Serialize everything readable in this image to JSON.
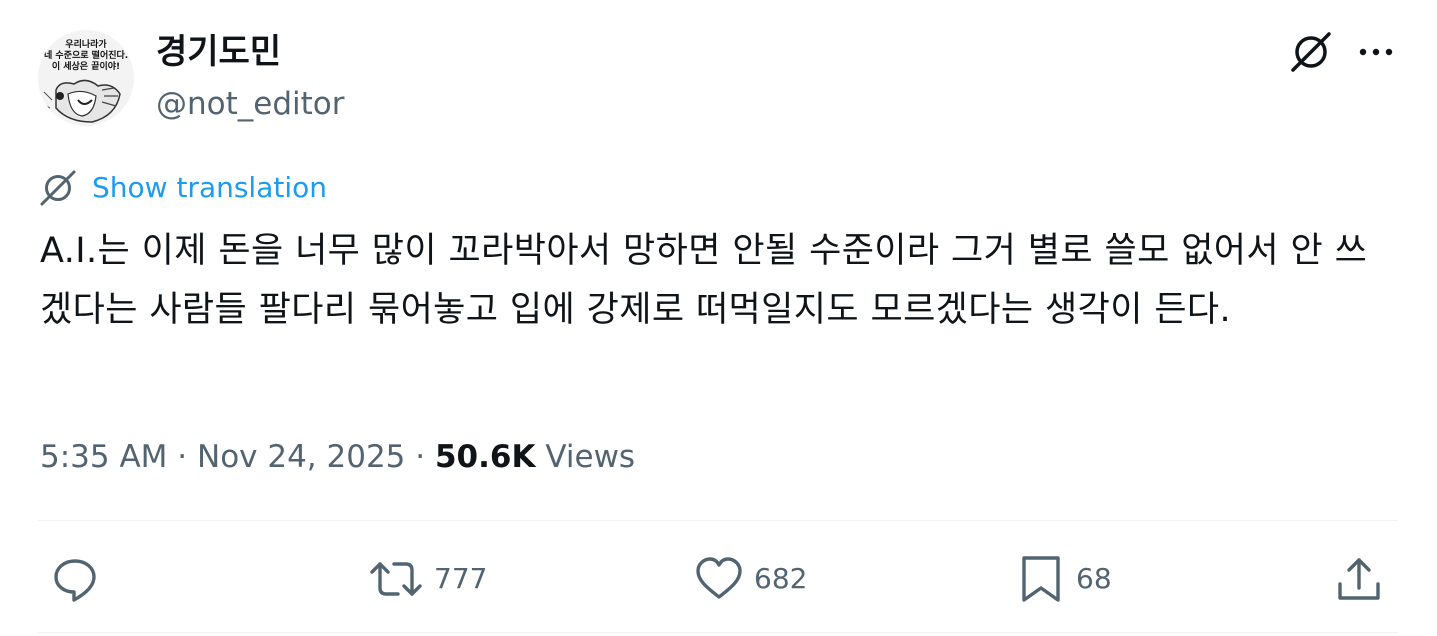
{
  "author": {
    "display_name": "경기도민",
    "handle": "@not_editor",
    "avatar_caption": [
      "우리나라가",
      "네 수준으로 떨어진다.",
      "이 세상은 끝이야!"
    ]
  },
  "header": {
    "grok_icon": "grok-icon",
    "more_icon": "more-icon"
  },
  "translate": {
    "label": "Show translation",
    "icon": "grok-icon"
  },
  "tweet": {
    "text": "A.I.는 이제 돈을 너무 많이 꼬라박아서 망하면 안될 수준이라 그거 별로 쓸모 없어서 안 쓰겠다는 사람들 팔다리 묶어놓고 입에 강제로 떠먹일지도 모르겠다는 생각이 든다."
  },
  "meta": {
    "time": "5:35 AM",
    "separator": "·",
    "date": "Nov 24, 2025",
    "views_count": "50.6K",
    "views_label": "Views"
  },
  "actions": {
    "reply": {
      "icon": "reply-icon",
      "count": ""
    },
    "repost": {
      "icon": "repost-icon",
      "count": "777"
    },
    "like": {
      "icon": "heart-icon",
      "count": "682"
    },
    "bookmark": {
      "icon": "bookmark-icon",
      "count": "68"
    },
    "share": {
      "icon": "share-icon",
      "count": ""
    }
  },
  "colors": {
    "text": "#0f1419",
    "secondary": "#536471",
    "link": "#1d9bf0",
    "divider": "#eff3f4"
  }
}
